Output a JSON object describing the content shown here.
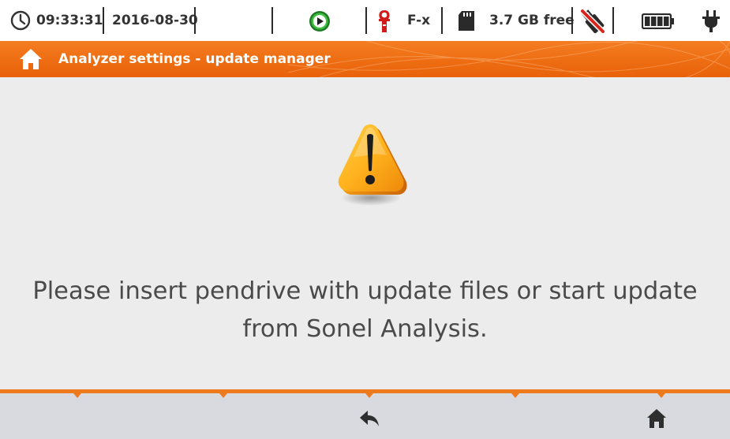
{
  "status_bar": {
    "time": "09:33:31",
    "date": "2016-08-30",
    "clamp_label": "F-x",
    "storage": "3.7 GB free",
    "icons": [
      "clock-icon",
      "play-status-icon",
      "clamp-icon",
      "sd-card-icon",
      "usb-disconnected-icon",
      "battery-icon",
      "power-plug-icon"
    ]
  },
  "title_bar": {
    "title": "Analyzer settings - update manager",
    "icon": "home-icon"
  },
  "main": {
    "icon": "warning-icon",
    "message": "Please insert pendrive with update files or start update from Sonel Analysis."
  },
  "bottom_bar": {
    "buttons": [
      {
        "name": "back",
        "icon": "back-arrow-icon"
      },
      {
        "name": "home",
        "icon": "home-icon"
      }
    ]
  },
  "colors": {
    "accent": "#ee6d12",
    "background": "#ececec",
    "bottom_bar": "#d9dadf",
    "status_ok": "#29a52f"
  }
}
